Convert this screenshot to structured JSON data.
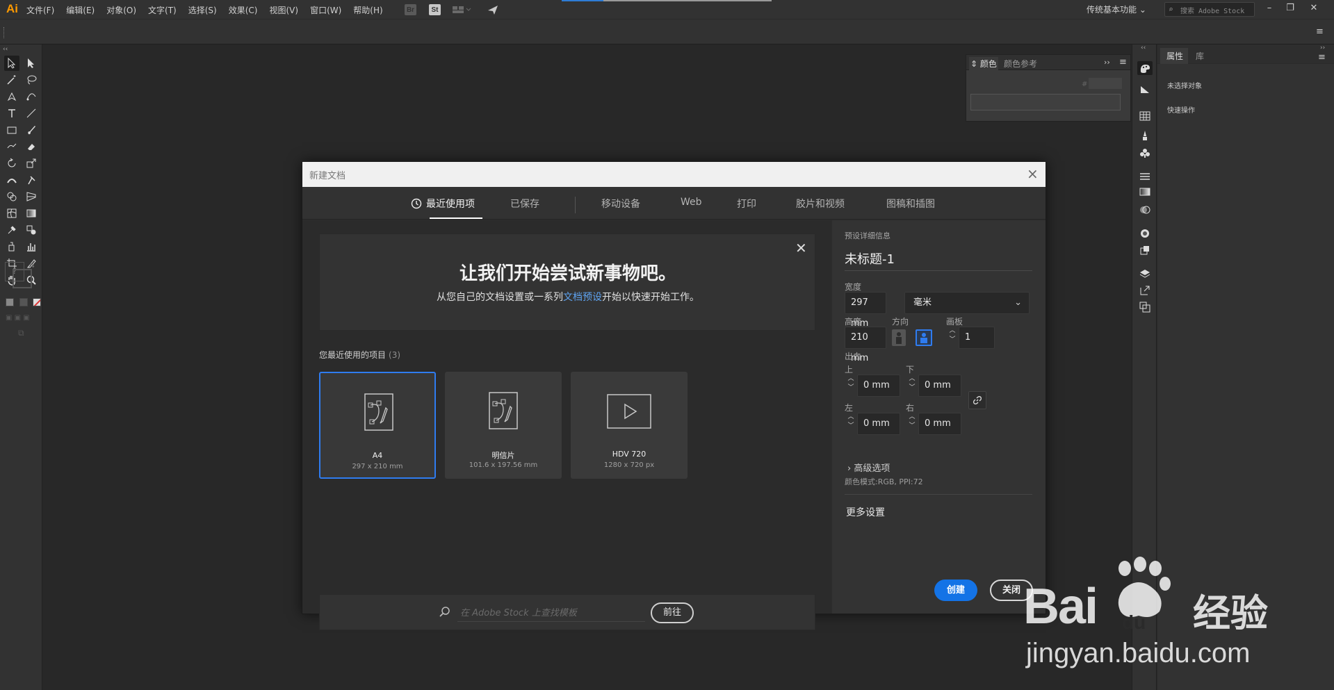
{
  "app": {
    "logo": "Ai",
    "menus": [
      "文件(F)",
      "编辑(E)",
      "对象(O)",
      "文字(T)",
      "选择(S)",
      "效果(C)",
      "视图(V)",
      "窗口(W)",
      "帮助(H)"
    ],
    "bridge_label": "Br",
    "stock_label": "St",
    "workspace": "传统基本功能",
    "stock_search_placeholder": "搜索 Adobe Stock"
  },
  "color_panel": {
    "tab_color": "颜色",
    "tab_color_guide": "颜色参考",
    "hash": "#"
  },
  "properties_panel": {
    "tab_properties": "属性",
    "tab_libraries": "库",
    "no_selection": "未选择对象",
    "quick_actions": "快速操作"
  },
  "dialog": {
    "title": "新建文档",
    "tabs": [
      "最近使用项",
      "已保存",
      "移动设备",
      "Web",
      "打印",
      "胶片和视频",
      "图稿和插图"
    ],
    "active_tab": "最近使用项",
    "hero": {
      "title": "让我们开始尝试新事物吧。",
      "sub_before": "从您自己的文档设置或一系列",
      "sub_link": "文档预设",
      "sub_after": "开始以快速开始工作。"
    },
    "recent": {
      "label": "您最近使用的项目",
      "count": "(3)",
      "items": [
        {
          "name": "A4",
          "size": "297 x 210 mm",
          "icon": "document-draw-icon",
          "selected": true
        },
        {
          "name": "明信片",
          "size": "101.6 x 197.56 mm",
          "icon": "document-draw-icon",
          "selected": false
        },
        {
          "name": "HDV 720",
          "size": "1280 x 720 px",
          "icon": "video-play-icon",
          "selected": false
        }
      ]
    },
    "search": {
      "placeholder": "在 Adobe Stock 上查找模板",
      "go_label": "前往"
    },
    "preset": {
      "section": "预设详细信息",
      "name": "未标题-1",
      "width_label": "宽度",
      "width": "297 mm",
      "unit": "毫米",
      "height_label": "高度",
      "height": "210 mm",
      "orientation_label": "方向",
      "artboards_label": "画板",
      "artboards": "1",
      "bleed_label": "出血",
      "top_label": "上",
      "top": "0 mm",
      "bottom_label": "下",
      "bottom": "0 mm",
      "left_label": "左",
      "left": "0 mm",
      "right_label": "右",
      "right": "0 mm",
      "advanced": "高级选项",
      "color_mode": "颜色模式:RGB, PPI:72",
      "more_settings": "更多设置"
    },
    "create_label": "创建",
    "close_label": "关闭"
  },
  "watermark": {
    "brand": "Bai",
    "brand_du": "du",
    "brand_cn": "经验",
    "url": "jingyan.baidu.com"
  },
  "colors": {
    "accent": "#1473e6",
    "selection_border": "#2f7cf0",
    "link": "#5ea3f0",
    "logo": "#ff9a00"
  }
}
